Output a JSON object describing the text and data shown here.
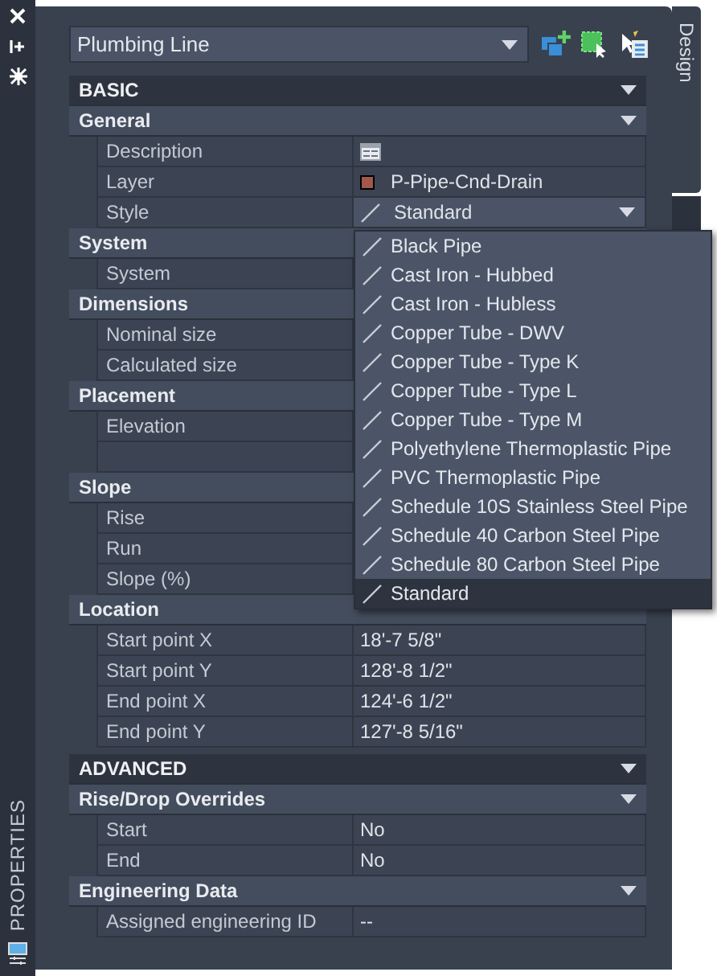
{
  "side_bar": {
    "tab_label": "PROPERTIES"
  },
  "object_type": {
    "value": "Plumbing Line"
  },
  "right_tab": {
    "label": "Design"
  },
  "groups": [
    {
      "title": "BASIC",
      "expanded": true,
      "sections": [
        {
          "title": "General",
          "expanded": true,
          "rows": [
            {
              "label": "Description",
              "kind": "icon"
            },
            {
              "label": "Layer",
              "kind": "swatch",
              "value": "P-Pipe-Cnd-Drain",
              "color": "#a0584a"
            },
            {
              "label": "Style",
              "kind": "dropdown",
              "value": "Standard"
            }
          ]
        },
        {
          "title": "System",
          "rows": [
            {
              "label": "System",
              "kind": "text"
            }
          ]
        },
        {
          "title": "Dimensions",
          "rows": [
            {
              "label": "Nominal size",
              "kind": "text"
            },
            {
              "label": "Calculated size",
              "kind": "text"
            }
          ]
        },
        {
          "title": "Placement",
          "rows": [
            {
              "label": "Elevation",
              "kind": "text"
            },
            {
              "kind": "blank"
            }
          ]
        },
        {
          "title": "Slope",
          "rows": [
            {
              "label": "Rise",
              "kind": "text"
            },
            {
              "label": "Run",
              "kind": "text"
            },
            {
              "label": "Slope (%)",
              "kind": "text"
            }
          ]
        },
        {
          "title": "Location",
          "rows": [
            {
              "label": "Start point X",
              "kind": "text",
              "value": "18'-7 5/8\""
            },
            {
              "label": "Start point Y",
              "kind": "text",
              "value": "128'-8 1/2\""
            },
            {
              "label": "End point X",
              "kind": "text",
              "value": "124'-6 1/2\""
            },
            {
              "label": "End point Y",
              "kind": "text",
              "value": "127'-8 5/16\""
            }
          ]
        }
      ]
    },
    {
      "title": "ADVANCED",
      "expanded": true,
      "sections": [
        {
          "title": "Rise/Drop Overrides",
          "expanded": true,
          "rows": [
            {
              "label": "Start",
              "kind": "text",
              "value": "No"
            },
            {
              "label": "End",
              "kind": "text",
              "value": "No"
            }
          ]
        },
        {
          "title": "Engineering Data",
          "expanded": true,
          "rows": [
            {
              "label": "Assigned engineering ID",
              "kind": "text",
              "value": "--"
            }
          ]
        }
      ]
    }
  ],
  "style_dropdown": {
    "options": [
      {
        "label": "Black Pipe",
        "selected": false
      },
      {
        "label": "Cast Iron - Hubbed",
        "selected": false
      },
      {
        "label": "Cast Iron - Hubless",
        "selected": false
      },
      {
        "label": "Copper Tube - DWV",
        "selected": false
      },
      {
        "label": "Copper Tube - Type K",
        "selected": false
      },
      {
        "label": "Copper Tube - Type L",
        "selected": false
      },
      {
        "label": "Copper Tube - Type M",
        "selected": false
      },
      {
        "label": "Polyethylene Thermoplastic Pipe",
        "selected": false
      },
      {
        "label": "PVC Thermoplastic Pipe",
        "selected": false
      },
      {
        "label": "Schedule 10S Stainless Steel Pipe",
        "selected": false
      },
      {
        "label": "Schedule 40 Carbon Steel Pipe",
        "selected": false
      },
      {
        "label": "Schedule 80 Carbon Steel Pipe",
        "selected": false
      },
      {
        "label": "Standard",
        "selected": true
      }
    ]
  }
}
